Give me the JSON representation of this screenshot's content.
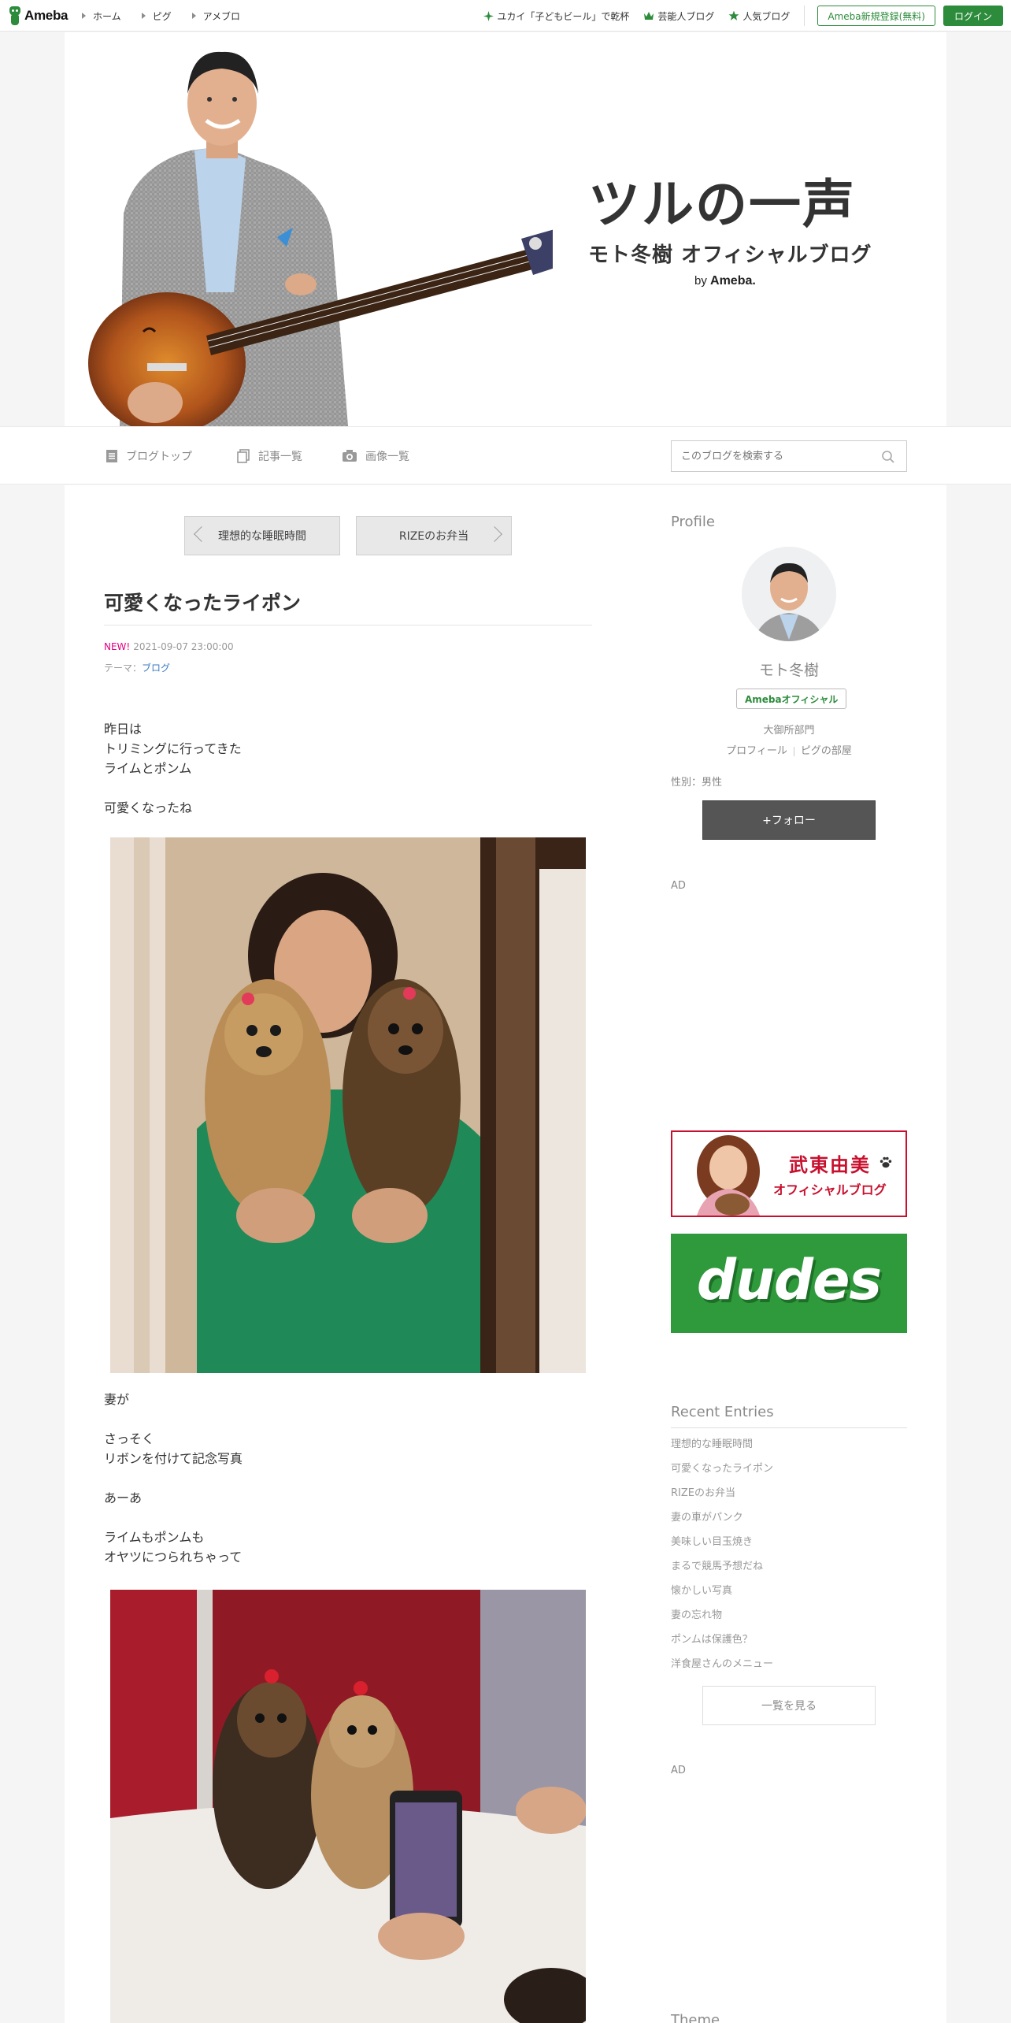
{
  "topbar": {
    "logo_text": "Ameba",
    "nav": [
      {
        "label": "ホーム"
      },
      {
        "label": "ピグ"
      },
      {
        "label": "アメブロ"
      }
    ],
    "links": [
      {
        "label": "ユカイ「子どもビール」で乾杯",
        "icon": "sparkle-icon"
      },
      {
        "label": "芸能人ブログ",
        "icon": "crown-icon"
      },
      {
        "label": "人気ブログ",
        "icon": "star-icon"
      }
    ],
    "register_label": "Ameba新規登録(無料)",
    "login_label": "ログイン",
    "accent_color": "#2d8c3c"
  },
  "header": {
    "title": "ツルの一声",
    "subtitle": "モト冬樹 オフィシャルブログ",
    "by_prefix": "by",
    "by_brand": "Ameba."
  },
  "blognav": {
    "items": [
      {
        "label": "ブログトップ",
        "icon": "document-icon"
      },
      {
        "label": "記事一覧",
        "icon": "copy-icon"
      },
      {
        "label": "画像一覧",
        "icon": "camera-icon"
      }
    ],
    "search_placeholder": "このブログを検索する"
  },
  "article": {
    "prev_label": "理想的な睡眠時間",
    "next_label": "RIZEのお弁当",
    "title": "可愛くなったライポン",
    "new_badge": "NEW!",
    "datetime": "2021-09-07 23:00:00",
    "theme_label": "テーマ：",
    "theme_link": "ブログ",
    "paragraphs": {
      "p1": [
        "昨日は",
        "トリミングに行ってきた",
        "ライムとポンム"
      ],
      "p2": [
        "可愛くなったね"
      ],
      "p3": [
        "妻が"
      ],
      "p4": [
        "さっそく",
        "リボンを付けて記念写真"
      ],
      "p5": [
        "あーあ"
      ],
      "p6": [
        "ライムもポンムも",
        "オヤツにつられちゃって"
      ]
    }
  },
  "sidebar": {
    "profile_heading": "Profile",
    "name": "モト冬樹",
    "badge": "Amebaオフィシャル",
    "office": "大御所部門",
    "profile_link": "プロフィール",
    "pig_link": "ピグの部屋",
    "gender": "性別：男性",
    "follow_label": "+フォロー",
    "ad_label_1": "AD",
    "banner1": {
      "title": "武東由美",
      "subtitle": "オフィシャルブログ",
      "color": "#c8102e"
    },
    "banner2": {
      "text": "dudes",
      "color": "#2f9a3c"
    },
    "recent_heading": "Recent Entries",
    "recent": [
      "理想的な睡眠時間",
      "可愛くなったライポン",
      "RIZEのお弁当",
      "妻の車がパンク",
      "美味しい目玉焼き",
      "まるで競馬予想だね",
      "懐かしい写真",
      "妻の忘れ物",
      "ポンムは保護色？",
      "洋食屋さんのメニュー"
    ],
    "more_label": "一覧を見る",
    "ad_label_2": "AD",
    "theme_heading": "Theme"
  }
}
